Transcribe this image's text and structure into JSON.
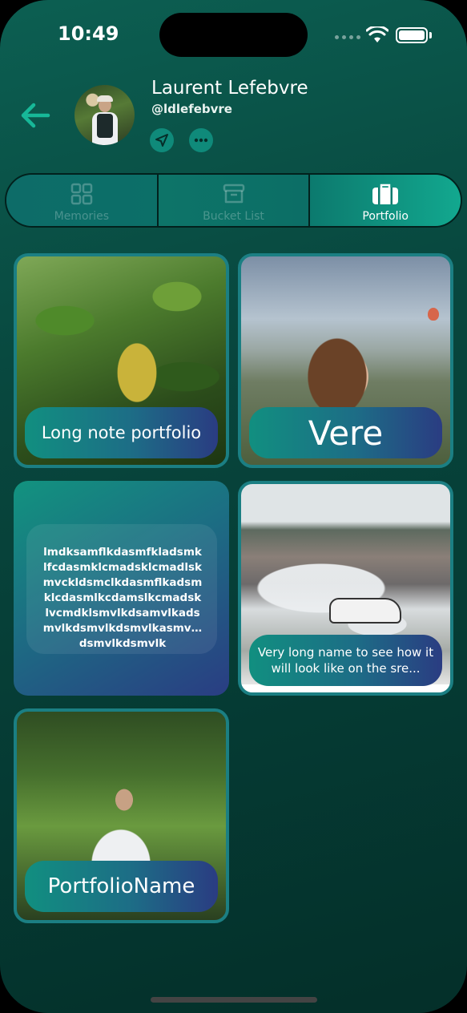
{
  "status_bar": {
    "time": "10:49"
  },
  "profile": {
    "name": "Laurent Lefebvre",
    "handle": "@ldlefebvre"
  },
  "tabs": [
    {
      "label": "Memories",
      "active": false
    },
    {
      "label": "Bucket List",
      "active": false
    },
    {
      "label": "Portfolio",
      "active": true
    }
  ],
  "portfolio": [
    {
      "title": "Long note portfolio",
      "type": "photo"
    },
    {
      "title": "Vere",
      "type": "photo"
    },
    {
      "title": "",
      "type": "note",
      "note": "lmdksamflkdasmfkladsmklfcdasmklcmadsklcmadlskmvckldsmclkdasmflkadsmklcdasmlkcdamslkcmadsklvcmdklsmvlkdsamvlkadsmvlkdsmvlkdsmvlkasmvlkdsmvlkdsmvlk"
    },
    {
      "title": "Very long name to see how it will look like on the sre...",
      "type": "photo"
    },
    {
      "title": "PortfolioName",
      "type": "photo"
    }
  ],
  "colors": {
    "accent": "#12a88f",
    "background": "#064a41",
    "card_border": "#1b7f83"
  }
}
